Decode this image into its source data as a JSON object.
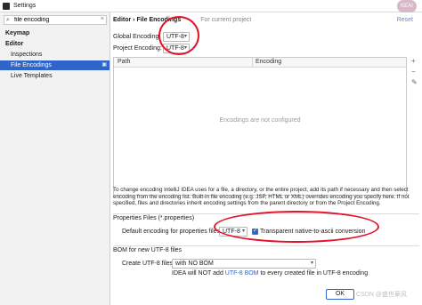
{
  "window": {
    "title": "Settings",
    "avatar_text": "KEAI"
  },
  "search": {
    "value": "file encoding",
    "clear": "×"
  },
  "sidebar": {
    "items": [
      {
        "label": "Keymap"
      },
      {
        "label": "Editor"
      },
      {
        "label": "Inspections"
      },
      {
        "label": "File Encodings",
        "selected": true
      },
      {
        "label": "Live Templates"
      }
    ]
  },
  "header": {
    "breadcrumb": "Editor › File Encodings",
    "scope": "For current project",
    "reset_label": "Reset"
  },
  "encodings": {
    "global_label": "Global Encoding:",
    "global_value": "UTF-8",
    "project_label": "Project Encoding:",
    "project_value": "UTF-8"
  },
  "table": {
    "columns": [
      "Path",
      "Encoding"
    ],
    "empty_text": "Encodings are not configured",
    "tools": [
      "+",
      "−",
      "✎"
    ]
  },
  "help_text": "To change encoding IntelliJ IDEA uses for a file, a directory, or the entire project, add its path if necessary and then select encoding from the encoding list. Built-in file encoding (e.g. JSP, HTML or XML) overrides encoding you specify here. If not specified, files and directories inherit encoding settings from the parent directory or from the Project Encoding.",
  "properties": {
    "section_title": "Properties Files (*.properties)",
    "default_label": "Default encoding for properties files:",
    "default_value": "UTF-8",
    "transparent_label": "Transparent native-to-ascii conversion",
    "transparent_checked": true
  },
  "bom": {
    "section_title": "BOM for new UTF-8 files",
    "create_label": "Create UTF-8 files:",
    "create_value": "with NO BOM",
    "note_prefix": "IDEA will NOT add",
    "note_link": "UTF-8 BOM",
    "note_suffix": "to every created file in UTF-8 encoding"
  },
  "footer": {
    "ok_label": "OK",
    "watermark": "CSDN @盛世豪风"
  },
  "colors": {
    "accent": "#2f65ca",
    "annotation": "#e3122a"
  },
  "icons": [
    "settings-app-icon",
    "search-icon",
    "chevron-down-icon",
    "checkbox-checked-icon"
  ]
}
